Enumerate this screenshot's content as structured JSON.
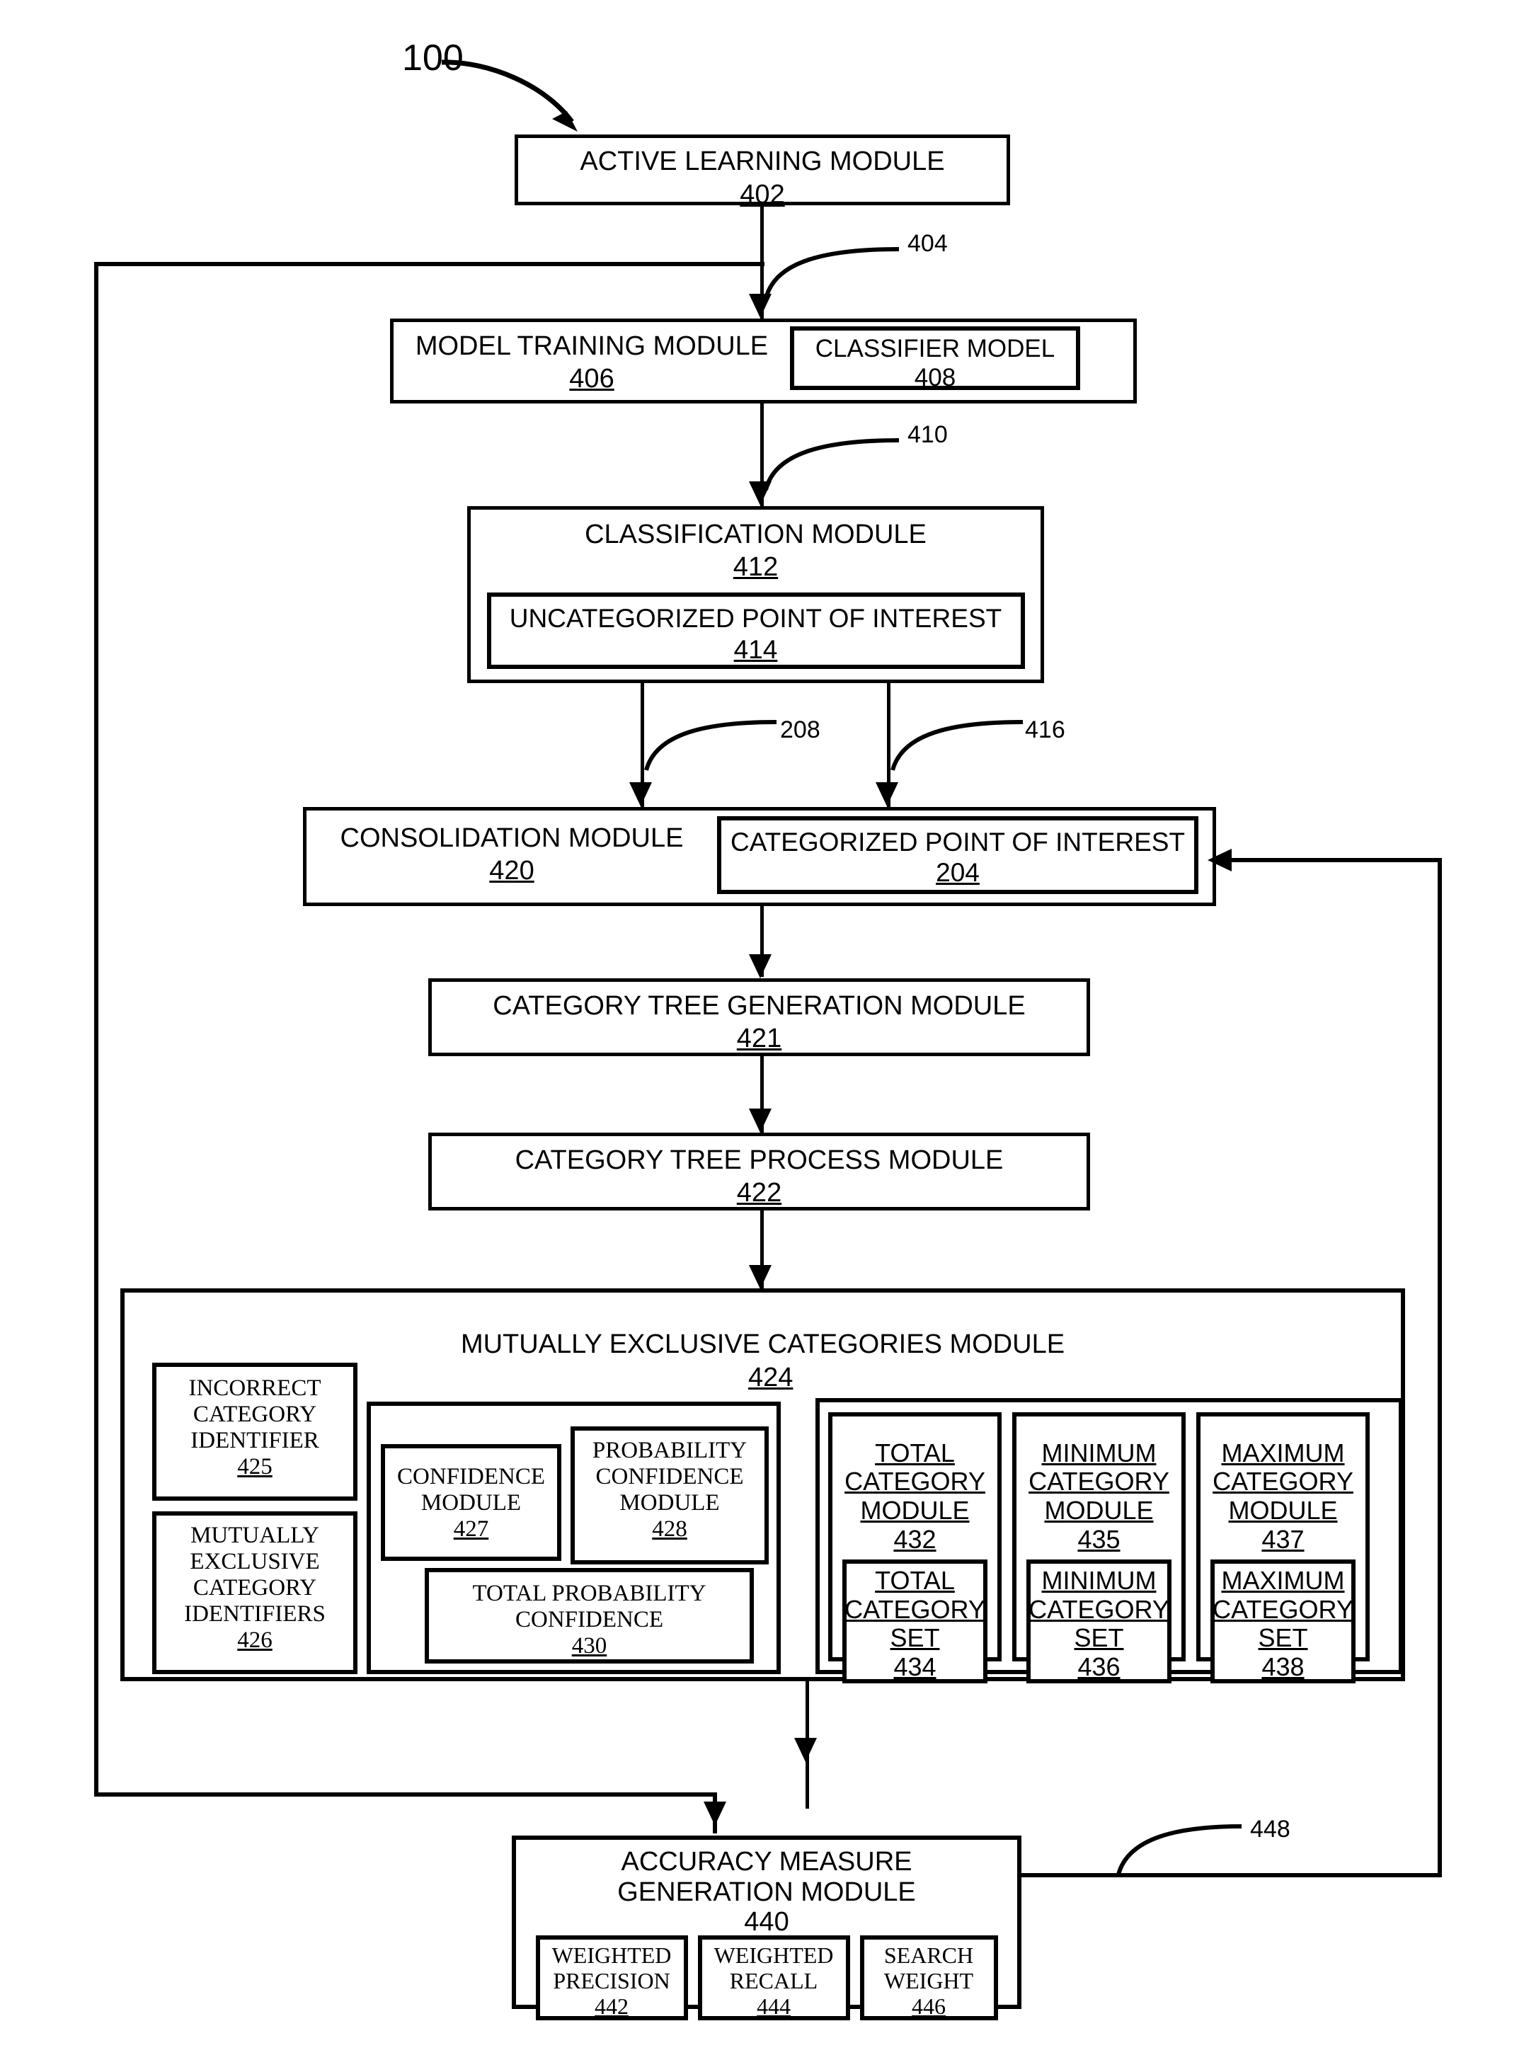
{
  "figure": {
    "figure_ref": "100",
    "callouts": [
      {
        "id": "c404",
        "text": "404"
      },
      {
        "id": "c410",
        "text": "410"
      },
      {
        "id": "c208",
        "text": "208"
      },
      {
        "id": "c416",
        "text": "416"
      },
      {
        "id": "c448",
        "text": "448"
      }
    ]
  },
  "blocks": {
    "active_learning": {
      "title": "ACTIVE LEARNING  MODULE",
      "number": "402"
    },
    "model_training": {
      "title": "MODEL TRAINING MODULE",
      "number": "406"
    },
    "classifier_model": {
      "title": "CLASSIFIER MODEL",
      "number": "408"
    },
    "classification": {
      "title": "CLASSIFICATION  MODULE",
      "number": "412"
    },
    "uncategorized_poi": {
      "title": "UNCATEGORIZED POINT OF INTEREST",
      "number": "414"
    },
    "consolidation": {
      "title": "CONSOLIDATION MODULE",
      "number": "420"
    },
    "categorized_poi": {
      "title": "CATEGORIZED POINT OF INTEREST",
      "number": "204"
    },
    "category_tree_generation": {
      "title": "CATEGORY TREE GENERATION MODULE",
      "number": "421"
    },
    "category_tree_process": {
      "title": "CATEGORY TREE PROCESS MODULE",
      "number": "422"
    },
    "mutually_exclusive": {
      "title": "MUTUALLY EXCLUSIVE CATEGORIES MODULE",
      "number": "424"
    },
    "incorrect_category_identifier": {
      "line1": "INCORRECT",
      "line2": "CATEGORY",
      "line3": "IDENTIFIER",
      "number": "425"
    },
    "mutually_exclusive_category_identifiers": {
      "line1": "MUTUALLY",
      "line2": "EXCLUSIVE",
      "line3": "CATEGORY",
      "line4": "IDENTIFIERS",
      "number": "426"
    },
    "confidence_module": {
      "line1": "CONFIDENCE",
      "line2": "MODULE",
      "number": "427"
    },
    "probability_confidence_module": {
      "line1": "PROBABILITY",
      "line2": "CONFIDENCE",
      "line3": "MODULE",
      "number": "428"
    },
    "total_probability_confidence": {
      "line1": "TOTAL PROBABILITY",
      "line2": "CONFIDENCE",
      "number": "430"
    },
    "total_category_module": {
      "line1": "TOTAL",
      "line2": "CATEGORY",
      "line3": "MODULE",
      "number": "432"
    },
    "total_category_set": {
      "line1": "TOTAL",
      "line2": "CATEGORY",
      "line3": "SET",
      "number": "434"
    },
    "minimum_category_module": {
      "line1": "MINIMUM",
      "line2": "CATEGORY",
      "line3": "MODULE",
      "number": "435"
    },
    "minimum_category_set": {
      "line1": "MINIMUM",
      "line2": "CATEGORY",
      "line3": "SET",
      "number": "436"
    },
    "maximum_category_module": {
      "line1": "MAXIMUM",
      "line2": "CATEGORY",
      "line3": "MODULE",
      "number": "437"
    },
    "maximum_category_set": {
      "line1": "MAXIMUM",
      "line2": "CATEGORY",
      "line3": "SET",
      "number": "438"
    },
    "accuracy_measure": {
      "line1": "ACCURACY MEASURE",
      "line2": "GENERATION  MODULE",
      "number": "440"
    },
    "weighted_precision": {
      "line1": "WEIGHTED",
      "line2": "PRECISION",
      "number": "442"
    },
    "weighted_recall": {
      "line1": "WEIGHTED",
      "line2": "RECALL",
      "number": "444"
    },
    "search_weight": {
      "line1": "SEARCH",
      "line2": "WEIGHT",
      "number": "446"
    }
  }
}
